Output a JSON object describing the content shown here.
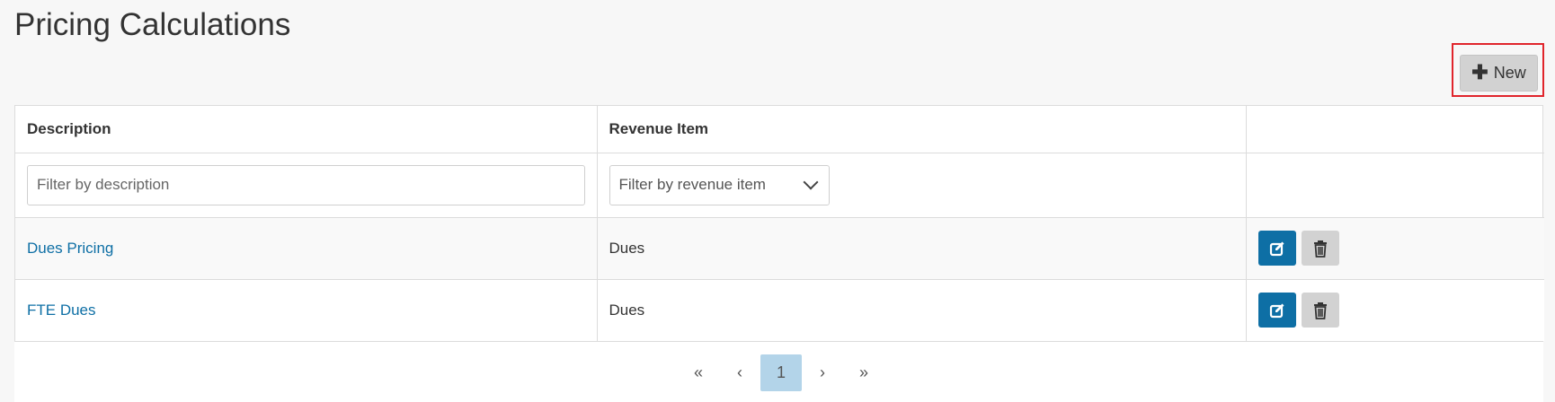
{
  "page": {
    "title": "Pricing Calculations"
  },
  "toolbar": {
    "new_label": "New",
    "new_icon": "plus-icon"
  },
  "table": {
    "columns": [
      "Description",
      "Revenue Item",
      ""
    ],
    "filters": {
      "description_placeholder": "Filter by description",
      "revenue_item_placeholder": "Filter by revenue item"
    },
    "rows": [
      {
        "description": "Dues Pricing",
        "revenue_item": "Dues"
      },
      {
        "description": "FTE Dues",
        "revenue_item": "Dues"
      }
    ]
  },
  "pagination": {
    "first": "«",
    "prev": "‹",
    "current": "1",
    "next": "›",
    "last": "»"
  },
  "colors": {
    "primary": "#0e6fa5",
    "highlight": "#e0242b",
    "neutral_button": "#d2d2d2",
    "active_page": "#b3d4e9"
  }
}
